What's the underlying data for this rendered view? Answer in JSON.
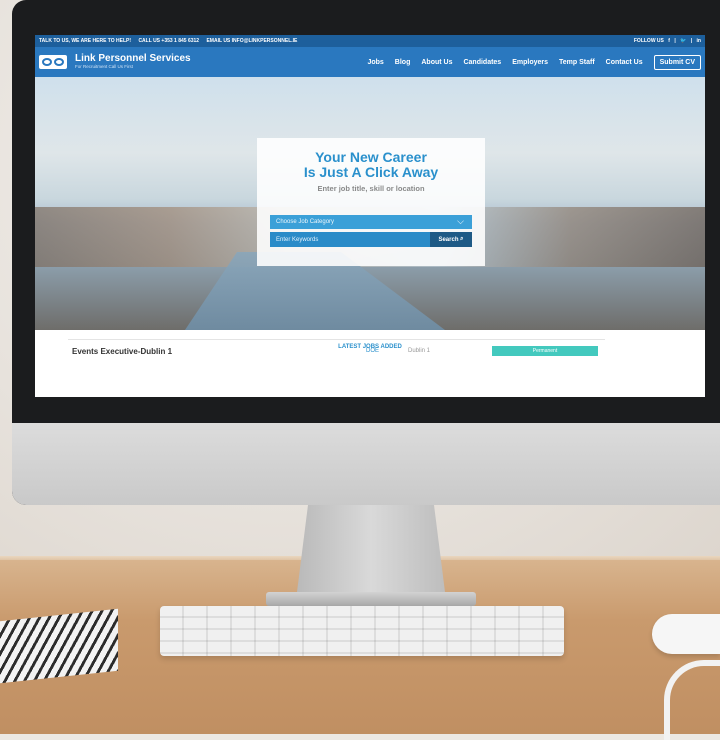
{
  "topbar": {
    "talk": "TALK TO US, WE ARE HERE TO HELP!",
    "call": "CALL US +353 1 845 6312",
    "email": "EMAIL US INFO@LINKPERSONNEL.IE",
    "follow": "FOLLOW US",
    "social": [
      "f",
      "|",
      "🐦",
      "|",
      "in"
    ]
  },
  "brand": {
    "name": "Link Personnel Services",
    "tagline": "For Recruitment Call Us First"
  },
  "nav": {
    "items": [
      "Jobs",
      "Blog",
      "About Us",
      "Candidates",
      "Employers",
      "Temp Staff",
      "Contact Us"
    ],
    "submit_label": "Submit CV"
  },
  "hero": {
    "title_line1": "Your New Career",
    "title_line2": "Is Just A Click Away",
    "subtitle": "Enter job title, skill or location",
    "category_placeholder": "Choose Job Category",
    "keywords_placeholder": "Enter Keywords",
    "search_label": "Search"
  },
  "latest": {
    "heading": "LATEST JOBS ADDED",
    "job": {
      "title": "Events Executive-Dublin 1",
      "salary": "DOE",
      "location": "Dublin 1",
      "type": "Permanent"
    }
  },
  "colors": {
    "topbar": "#1d5f9c",
    "navbar": "#2a78bf",
    "accent": "#2a90cc",
    "badge": "#43c9be"
  }
}
